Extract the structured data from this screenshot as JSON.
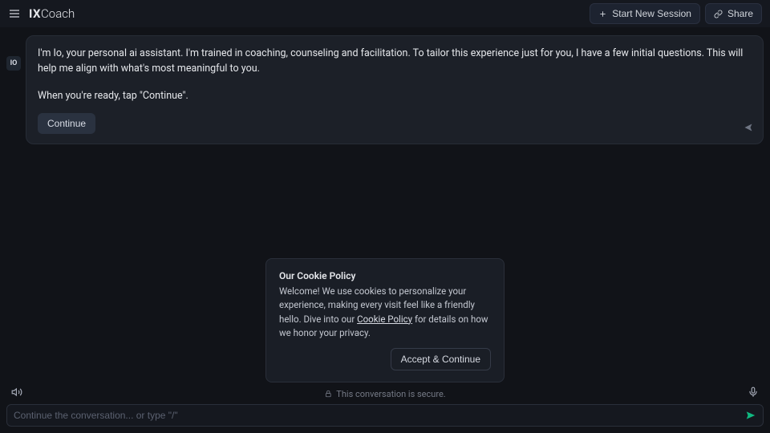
{
  "header": {
    "logo_bold": "IX",
    "logo_light": "Coach",
    "start_label": "Start New Session",
    "share_label": "Share"
  },
  "chat": {
    "avatar": "IO",
    "p1": "I'm Io, your personal ai assistant. I'm trained in coaching, counseling and facilitation. To tailor this experience just for you, I have a few initial questions. This will help me align with what's most meaningful to you.",
    "p2": "When you're ready, tap \"Continue\".",
    "continue_label": "Continue"
  },
  "cookie": {
    "title": "Our Cookie Policy",
    "body_pre": "Welcome! We use cookies to personalize your experience, making every visit feel like a friendly hello. Dive into our ",
    "link_text": "Cookie Policy",
    "body_post": " for details on how we honor your privacy.",
    "accept_label": "Accept & Continue"
  },
  "footer": {
    "secure_text": "This conversation is secure.",
    "input_placeholder": "Continue the conversation... or type \"/\""
  }
}
